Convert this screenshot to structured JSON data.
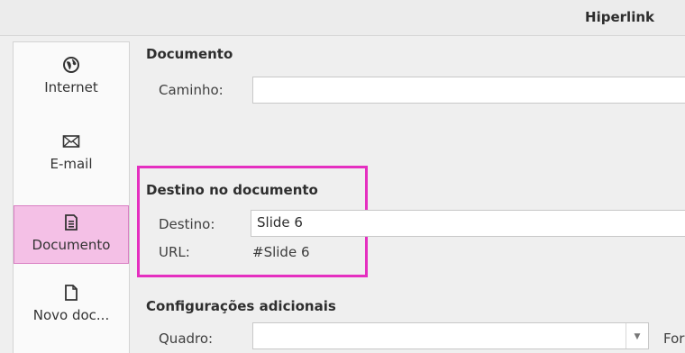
{
  "window": {
    "title": "Hiperlink"
  },
  "sidebar": {
    "items": [
      {
        "label": "Internet",
        "icon": "globe-icon"
      },
      {
        "label": "E-mail",
        "icon": "envelope-icon"
      },
      {
        "label": "Documento",
        "icon": "document-icon",
        "selected": true
      },
      {
        "label": "Novo doc...",
        "icon": "new-document-icon"
      }
    ]
  },
  "document_section": {
    "title": "Documento",
    "path_label": "Caminho:",
    "path_value": ""
  },
  "target_section": {
    "title": "Destino no documento",
    "target_label": "Destino:",
    "target_value": "Slide 6",
    "url_label": "URL:",
    "url_value": "#Slide 6"
  },
  "additional_section": {
    "title": "Configurações adicionais",
    "frame_label": "Quadro:",
    "frame_value": "",
    "form_label_partial": "For"
  },
  "colors": {
    "selection": "#f4c0e6",
    "highlight": "#e52fc0"
  }
}
